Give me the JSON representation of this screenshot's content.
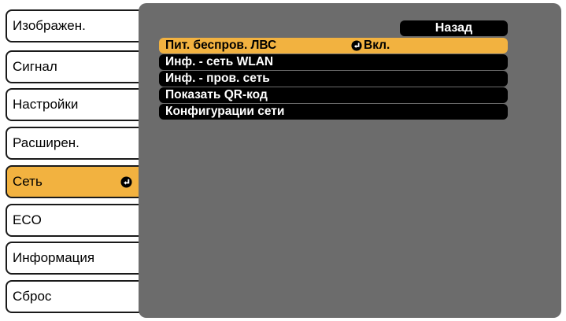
{
  "sidebar": {
    "items": [
      {
        "label": "Изображен."
      },
      {
        "label": "Сигнал"
      },
      {
        "label": "Настройки"
      },
      {
        "label": "Расширен."
      },
      {
        "label": "Сеть",
        "icon": "enter-icon"
      },
      {
        "label": "ECO"
      },
      {
        "label": "Информация"
      },
      {
        "label": "Сброс"
      }
    ]
  },
  "panel": {
    "back_label": "Назад",
    "items": [
      {
        "label": "Пит. беспров. ЛВС",
        "value": "Вкл.",
        "value_icon": "enter-icon"
      },
      {
        "label": "Инф. - сеть WLAN"
      },
      {
        "label": "Инф. - пров. сеть"
      },
      {
        "label": "Показать QR-код"
      },
      {
        "label": "Конфигурации сети"
      }
    ]
  },
  "colors": {
    "accent": "#f2b240",
    "panel": "#6c6c6c",
    "item_bg": "#000000"
  }
}
